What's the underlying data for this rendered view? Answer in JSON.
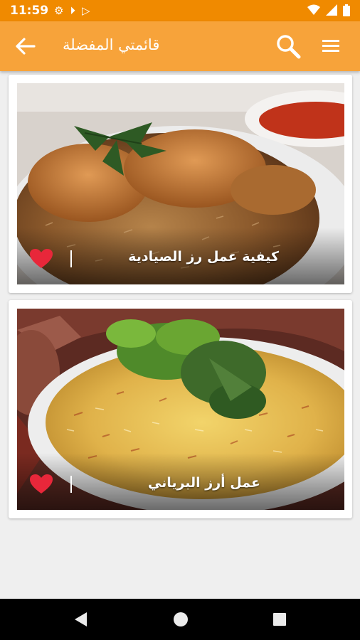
{
  "status_bar": {
    "time": "11:59",
    "icons_left": [
      "settings-icon",
      "media-icon",
      "play-store-icon"
    ],
    "icons_right": [
      "wifi-icon",
      "signal-icon",
      "battery-icon"
    ]
  },
  "app_bar": {
    "title": "قائمتي المفضلة",
    "back_icon": "arrow-left-icon",
    "search_icon": "search-icon",
    "menu_icon": "menu-icon",
    "color": "#f7a33a"
  },
  "favorites": [
    {
      "title": "كيفية عمل رز الصيادية",
      "favorite": true,
      "image": "fish-rice-dish"
    },
    {
      "title": "عمل أرز البرياني",
      "favorite": true,
      "image": "biryani-rice-dish"
    }
  ],
  "colors": {
    "status_bar": "#f08a00",
    "heart": "#e8273a",
    "background": "#efefef"
  },
  "nav_bar": {
    "buttons": [
      "back-triangle-icon",
      "home-circle-icon",
      "recents-square-icon"
    ]
  }
}
